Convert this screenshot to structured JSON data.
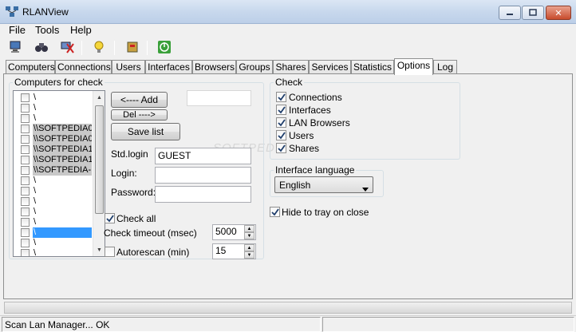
{
  "window": {
    "title": "RLANView",
    "close_glyph": "✕"
  },
  "menu": [
    "File",
    "Tools",
    "Help"
  ],
  "toolbar_icons": [
    "scan-computers-icon",
    "binoculars-icon",
    "computer-remove-icon",
    "lightbulb-icon",
    "lan-manager-icon",
    "power-icon"
  ],
  "tabs": [
    "Computers",
    "Connections",
    "Users",
    "Interfaces",
    "Browsers",
    "Groups",
    "Shares",
    "Services",
    "Statistics",
    "Options",
    "Log"
  ],
  "active_tab": "Options",
  "watermark": "SOFTPEDIA",
  "computers_group": {
    "label": "Computers for check",
    "items": [
      {
        "text": "\\",
        "checked": false,
        "style": "plain"
      },
      {
        "text": "\\",
        "checked": false,
        "style": "plain"
      },
      {
        "text": "\\",
        "checked": false,
        "style": "plain"
      },
      {
        "text": "\\\\SOFTPEDIA0",
        "checked": false,
        "style": "sel"
      },
      {
        "text": "\\\\SOFTPEDIA0",
        "checked": false,
        "style": "sel"
      },
      {
        "text": "\\\\SOFTPEDIA1",
        "checked": false,
        "style": "sel"
      },
      {
        "text": "\\\\SOFTPEDIA1",
        "checked": false,
        "style": "sel"
      },
      {
        "text": "\\\\SOFTPEDIA-E",
        "checked": false,
        "style": "sel"
      },
      {
        "text": "\\",
        "checked": false,
        "style": "plain"
      },
      {
        "text": "\\",
        "checked": false,
        "style": "plain"
      },
      {
        "text": "\\",
        "checked": false,
        "style": "plain"
      },
      {
        "text": "\\",
        "checked": false,
        "style": "plain"
      },
      {
        "text": "\\",
        "checked": false,
        "style": "plain"
      },
      {
        "text": "\\",
        "checked": false,
        "style": "hl"
      },
      {
        "text": "\\",
        "checked": false,
        "style": "plain"
      },
      {
        "text": "\\",
        "checked": false,
        "style": "plain"
      }
    ],
    "add_label": "<---- Add",
    "del_label": "Del ---->",
    "save_label": "Save list",
    "add_field_value": "",
    "std_login_label": "Std.login",
    "std_login_value": "GUEST",
    "login_label": "Login:",
    "login_value": "",
    "password_label": "Password:",
    "password_value": "",
    "check_all_label": "Check all",
    "check_all_checked": true,
    "timeout_label": "Check timeout (msec)",
    "timeout_value": "5000",
    "autorescan_label": "Autorescan (min)",
    "autorescan_checked": false,
    "autorescan_value": "15"
  },
  "check_group": {
    "label": "Check",
    "items": [
      {
        "label": "Connections",
        "checked": true
      },
      {
        "label": "Interfaces",
        "checked": true
      },
      {
        "label": "LAN Browsers",
        "checked": true
      },
      {
        "label": "Users",
        "checked": true
      },
      {
        "label": "Shares",
        "checked": true
      }
    ]
  },
  "language_group": {
    "label": "Interface language",
    "selected": "English"
  },
  "hide_tray": {
    "label": "Hide to tray on close",
    "checked": true
  },
  "status": {
    "text": "Scan Lan Manager... OK"
  }
}
